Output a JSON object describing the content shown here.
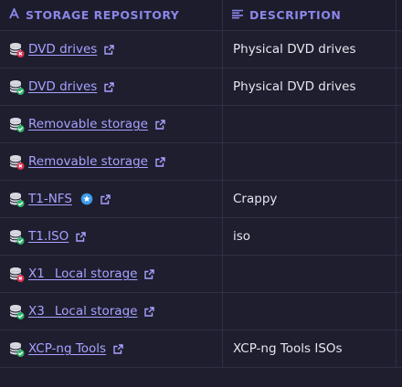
{
  "header": {
    "col_name": "STORAGE REPOSITORY",
    "col_desc": "DESCRIPTION"
  },
  "colors": {
    "accent": "#8c86e8",
    "link": "#a8a2ff",
    "status_ok": "#2fb36a",
    "status_err": "#e0344f"
  },
  "rows": [
    {
      "name": "DVD drives",
      "description": "Physical DVD drives",
      "status": "error"
    },
    {
      "name": "DVD drives",
      "description": "Physical DVD drives",
      "status": "ok"
    },
    {
      "name": "Removable storage",
      "description": "",
      "status": "ok"
    },
    {
      "name": "Removable storage",
      "description": "",
      "status": "error"
    },
    {
      "name": "T1-NFS",
      "description": "Crappy",
      "status": "ok",
      "default": true
    },
    {
      "name": "T1.ISO",
      "description": "iso",
      "status": "ok"
    },
    {
      "name": "X1 _Local storage",
      "description": "",
      "status": "error"
    },
    {
      "name": "X3 _Local storage",
      "description": "",
      "status": "ok"
    },
    {
      "name": "XCP-ng Tools",
      "description": "XCP-ng Tools ISOs",
      "status": "ok"
    }
  ]
}
